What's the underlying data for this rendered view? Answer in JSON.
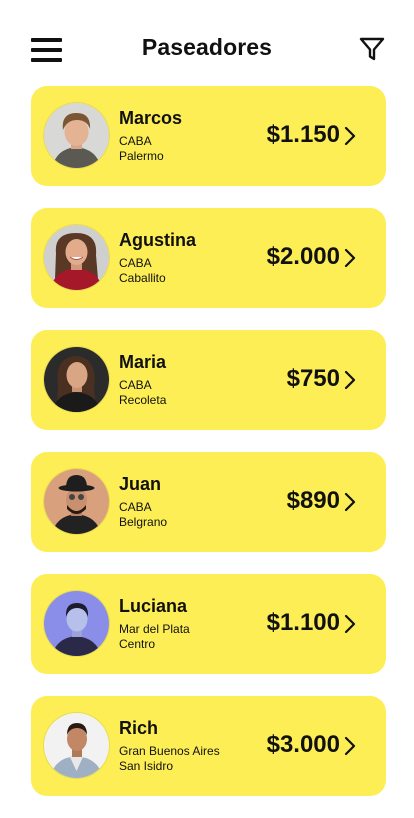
{
  "header": {
    "title": "Paseadores"
  },
  "walkers": [
    {
      "name": "Marcos",
      "city": "CABA",
      "area": "Palermo",
      "price": "$1.150"
    },
    {
      "name": "Agustina",
      "city": "CABA",
      "area": "Caballito",
      "price": "$2.000"
    },
    {
      "name": "Maria",
      "city": "CABA",
      "area": "Recoleta",
      "price": "$750"
    },
    {
      "name": "Juan",
      "city": "CABA",
      "area": "Belgrano",
      "price": "$890"
    },
    {
      "name": "Luciana",
      "city": "Mar del Plata",
      "area": "Centro",
      "price": "$1.100"
    },
    {
      "name": "Rich",
      "city": "Gran Buenos Aires",
      "area": "San Isidro",
      "price": "$3.000"
    }
  ],
  "colors": {
    "card": "#fdee55",
    "text": "#111111"
  },
  "icons": {
    "menu": "hamburger-menu-icon",
    "filter": "filter-funnel-icon",
    "chevron": "chevron-right-icon"
  }
}
